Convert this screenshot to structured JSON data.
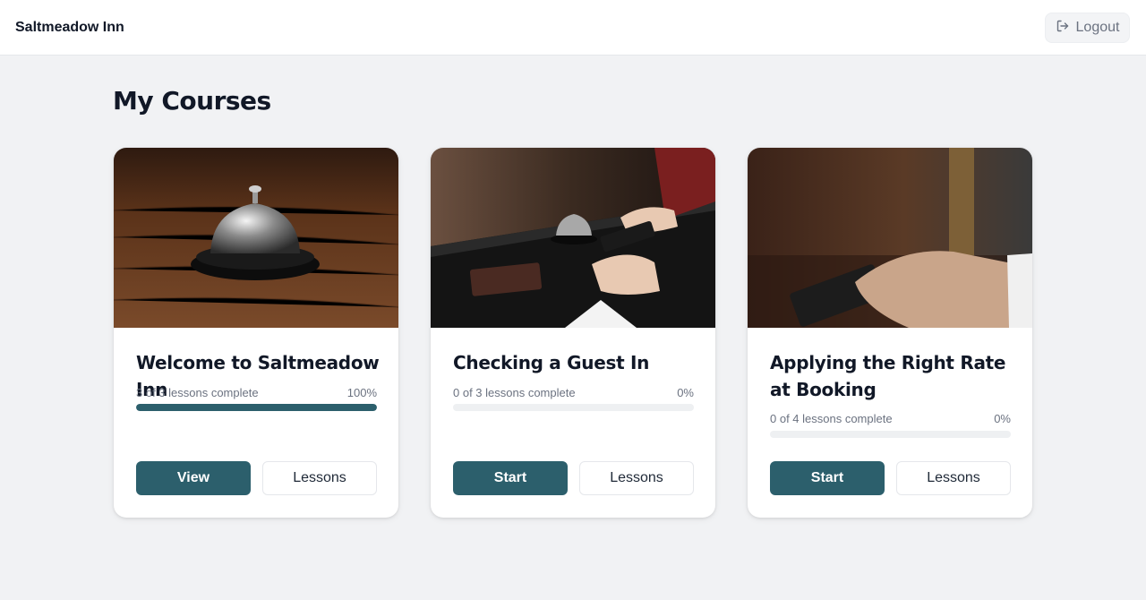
{
  "header": {
    "brand": "Saltmeadow Inn",
    "logout_label": "Logout"
  },
  "main": {
    "title": "My Courses",
    "courses": [
      {
        "title": "Welcome to Saltmeadow Inn",
        "progress_text": "3 of 3 lessons complete",
        "percent_label": "100%",
        "progress": 1.0,
        "primary_label": "View",
        "secondary_label": "Lessons"
      },
      {
        "title": "Checking a Guest In",
        "progress_text": "0 of 3 lessons complete",
        "percent_label": "0%",
        "progress": 0.0,
        "primary_label": "Start",
        "secondary_label": "Lessons"
      },
      {
        "title": "Applying the Right Rate at Booking",
        "progress_text": "0 of 4 lessons complete",
        "percent_label": "0%",
        "progress": 0.0,
        "primary_label": "Start",
        "secondary_label": "Lessons"
      }
    ]
  },
  "colors": {
    "accent": "#2c5f6c",
    "background": "#f1f2f4",
    "track": "#eef0f2"
  },
  "icons": {
    "logout": "logout-icon"
  }
}
